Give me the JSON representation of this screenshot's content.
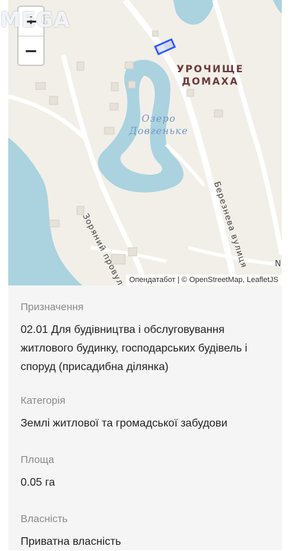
{
  "logo": {
    "text": "MEGA"
  },
  "map": {
    "zoom_in": "+",
    "zoom_out": "−",
    "place_label_line1": "УРОЧИЩЕ",
    "place_label_line2": "ДОМАХА",
    "lake_label_line1": "Озеро",
    "lake_label_line2": "Довгеньке",
    "street_1": "Зоряний провулок",
    "street_2": "Березнева вулиця",
    "edge_text": "N",
    "attribution": "Опендатабот | © OpenStreetMap, LeafletJS",
    "colors": {
      "land": "#f2efe9",
      "water": "#aad3df",
      "road": "#ffffff",
      "parcel": "#2b57ff"
    }
  },
  "fields": [
    {
      "label": "Призначення",
      "value_lines": [
        "02.01 Для будівництва і обслуговування",
        "житлового будинку, господарських будівель і",
        "споруд (присадибна ділянка)"
      ]
    },
    {
      "label": "Категорія",
      "value_lines": [
        "Землі житлової та громадської забудови"
      ]
    },
    {
      "label": "Площа",
      "value_lines": [
        "0.05 га"
      ]
    },
    {
      "label": "Власність",
      "value_lines": [
        "Приватна власність"
      ]
    }
  ]
}
